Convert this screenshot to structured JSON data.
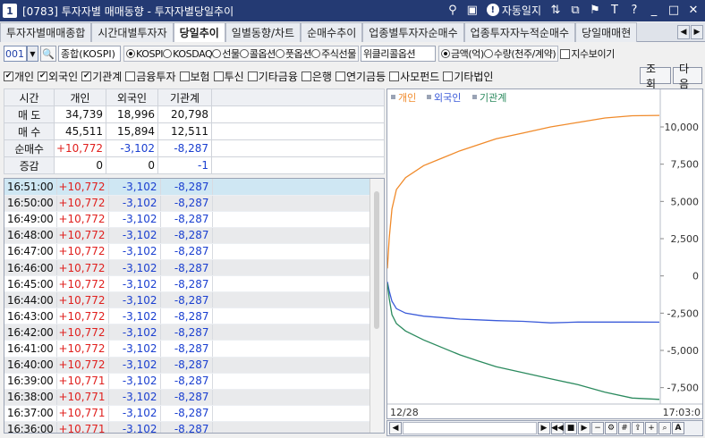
{
  "window": {
    "number": "1",
    "title": "[0783] 투자자별 매매동향 - 투자자별당일추이",
    "journal_label": "자동일지",
    "tools": [
      "pin-icon",
      "view-icon",
      "journal-icon",
      "link-icon",
      "split-icon",
      "tag-icon",
      "font-icon",
      "help-icon",
      "minimize-icon",
      "maximize-icon",
      "close-icon"
    ]
  },
  "tabs": [
    {
      "label": "투자자별매매종합",
      "active": false
    },
    {
      "label": "시간대별투자자",
      "active": false
    },
    {
      "label": "당일추이",
      "active": true
    },
    {
      "label": "일별동향/차트",
      "active": false
    },
    {
      "label": "순매수추이",
      "active": false
    },
    {
      "label": "업종별투자자순매수",
      "active": false
    },
    {
      "label": "업종투자자누적순매수",
      "active": false
    },
    {
      "label": "당일매매현",
      "active": false
    }
  ],
  "market": {
    "code": "001",
    "name": "종합(KOSPI)",
    "radios": [
      {
        "label": "KOSPI",
        "on": true
      },
      {
        "label": "KOSDAQ",
        "on": false
      },
      {
        "label": "선물",
        "on": false
      },
      {
        "label": "콜옵션",
        "on": false
      },
      {
        "label": "풋옵션",
        "on": false
      },
      {
        "label": "주식선물",
        "on": false
      }
    ],
    "weekly": "위클리콜옵션",
    "unit_radios": [
      {
        "label": "금액(억)",
        "on": true
      },
      {
        "label": "수량(천주/계약)",
        "on": false
      }
    ],
    "index_check": {
      "label": "지수보이기",
      "checked": false
    }
  },
  "investors": [
    {
      "label": "개인",
      "checked": true
    },
    {
      "label": "외국인",
      "checked": true
    },
    {
      "label": "기관계",
      "checked": true
    },
    {
      "label": "금융투자",
      "checked": false
    },
    {
      "label": "보험",
      "checked": false
    },
    {
      "label": "투신",
      "checked": false
    },
    {
      "label": "기타금융",
      "checked": false
    },
    {
      "label": "은행",
      "checked": false
    },
    {
      "label": "연기금등",
      "checked": false
    },
    {
      "label": "사모펀드",
      "checked": false
    },
    {
      "label": "기타법인",
      "checked": false
    }
  ],
  "buttons": {
    "query": "조회",
    "next": "다음"
  },
  "summary": {
    "headers": [
      "시간",
      "개인",
      "외국인",
      "기관계",
      ""
    ],
    "rows": [
      {
        "label": "매 도",
        "values": [
          "34,739",
          "18,996",
          "20,798"
        ]
      },
      {
        "label": "매 수",
        "values": [
          "45,511",
          "15,894",
          "12,511"
        ]
      },
      {
        "label": "순매수",
        "values": [
          "+10,772",
          "-3,102",
          "-8,287"
        ]
      },
      {
        "label": "증감",
        "values": [
          "0",
          "0",
          "-1"
        ]
      }
    ]
  },
  "timeline": [
    {
      "time": "16:51:00",
      "ind": "+10,772",
      "for": "-3,102",
      "inst": "-8,287"
    },
    {
      "time": "16:50:00",
      "ind": "+10,772",
      "for": "-3,102",
      "inst": "-8,287"
    },
    {
      "time": "16:49:00",
      "ind": "+10,772",
      "for": "-3,102",
      "inst": "-8,287"
    },
    {
      "time": "16:48:00",
      "ind": "+10,772",
      "for": "-3,102",
      "inst": "-8,287"
    },
    {
      "time": "16:47:00",
      "ind": "+10,772",
      "for": "-3,102",
      "inst": "-8,287"
    },
    {
      "time": "16:46:00",
      "ind": "+10,772",
      "for": "-3,102",
      "inst": "-8,287"
    },
    {
      "time": "16:45:00",
      "ind": "+10,772",
      "for": "-3,102",
      "inst": "-8,287"
    },
    {
      "time": "16:44:00",
      "ind": "+10,772",
      "for": "-3,102",
      "inst": "-8,287"
    },
    {
      "time": "16:43:00",
      "ind": "+10,772",
      "for": "-3,102",
      "inst": "-8,287"
    },
    {
      "time": "16:42:00",
      "ind": "+10,772",
      "for": "-3,102",
      "inst": "-8,287"
    },
    {
      "time": "16:41:00",
      "ind": "+10,772",
      "for": "-3,102",
      "inst": "-8,287"
    },
    {
      "time": "16:40:00",
      "ind": "+10,772",
      "for": "-3,102",
      "inst": "-8,287"
    },
    {
      "time": "16:39:00",
      "ind": "+10,771",
      "for": "-3,102",
      "inst": "-8,287"
    },
    {
      "time": "16:38:00",
      "ind": "+10,771",
      "for": "-3,102",
      "inst": "-8,287"
    },
    {
      "time": "16:37:00",
      "ind": "+10,771",
      "for": "-3,102",
      "inst": "-8,287"
    },
    {
      "time": "16:36:00",
      "ind": "+10,771",
      "for": "-3,102",
      "inst": "-8,287"
    }
  ],
  "colors": {
    "positive": "#e0201e",
    "negative": "#1a3fd0",
    "individual": "#f08a2a",
    "foreign": "#3b5bd9",
    "institution": "#2b8a5e"
  },
  "chart_data": {
    "type": "line",
    "legend_position": "top-left",
    "x_start_label": "12/28",
    "x_end_label": "17:03:0",
    "ylim": [
      -8600,
      11800
    ],
    "yticks": [
      10000,
      7500,
      5000,
      2500,
      0,
      -2500,
      -5000,
      -7500
    ],
    "ytick_labels": [
      "10,000",
      "7,500",
      "5,000",
      "2,500",
      "0",
      "-2,500",
      "-5,000",
      "-7,500"
    ],
    "x": [
      0,
      2,
      5,
      10,
      20,
      40,
      60,
      80,
      100,
      120,
      150,
      180,
      210,
      240,
      270,
      300
    ],
    "series": [
      {
        "name": "개인",
        "color": "#f08a2a",
        "values": [
          500,
          2500,
          4500,
          5800,
          6600,
          7400,
          7900,
          8400,
          8800,
          9200,
          9600,
          10000,
          10300,
          10600,
          10750,
          10772
        ]
      },
      {
        "name": "외국인",
        "color": "#3b5bd9",
        "values": [
          -400,
          -1000,
          -1700,
          -2200,
          -2500,
          -2700,
          -2800,
          -2900,
          -2950,
          -3000,
          -3050,
          -3150,
          -3100,
          -3100,
          -3100,
          -3102
        ]
      },
      {
        "name": "기관계",
        "color": "#2b8a5e",
        "values": [
          -500,
          -1500,
          -2600,
          -3200,
          -3700,
          -4300,
          -4800,
          -5300,
          -5700,
          -6100,
          -6500,
          -6900,
          -7300,
          -7800,
          -8200,
          -8287
        ]
      }
    ]
  }
}
